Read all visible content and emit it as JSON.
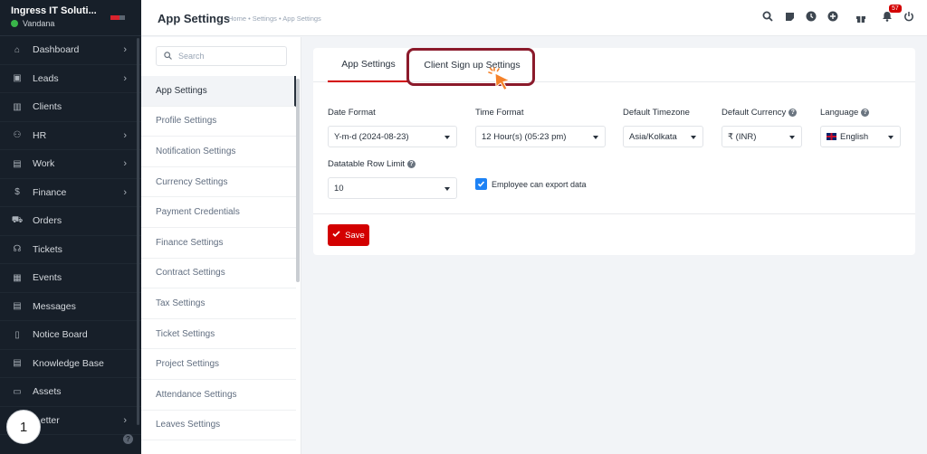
{
  "brand": {
    "name": "Ingress IT Soluti...",
    "user": "Vandana"
  },
  "sidebar": {
    "items": [
      {
        "label": "Dashboard",
        "icon": "home-icon",
        "glyph": "⌂",
        "chevron": true
      },
      {
        "label": "Leads",
        "icon": "leads-icon",
        "glyph": "▣",
        "chevron": true
      },
      {
        "label": "Clients",
        "icon": "clients-icon",
        "glyph": "▥",
        "chevron": false
      },
      {
        "label": "HR",
        "icon": "hr-icon",
        "glyph": "⚇",
        "chevron": true
      },
      {
        "label": "Work",
        "icon": "work-icon",
        "glyph": "▤",
        "chevron": true
      },
      {
        "label": "Finance",
        "icon": "finance-icon",
        "glyph": "$",
        "chevron": true
      },
      {
        "label": "Orders",
        "icon": "orders-icon",
        "glyph": "⛟",
        "chevron": false
      },
      {
        "label": "Tickets",
        "icon": "tickets-icon",
        "glyph": "☊",
        "chevron": false
      },
      {
        "label": "Events",
        "icon": "events-icon",
        "glyph": "▦",
        "chevron": false
      },
      {
        "label": "Messages",
        "icon": "messages-icon",
        "glyph": "▤",
        "chevron": false
      },
      {
        "label": "Notice Board",
        "icon": "notice-board-icon",
        "glyph": "▯",
        "chevron": false
      },
      {
        "label": "Knowledge Base",
        "icon": "knowledge-base-icon",
        "glyph": "▤",
        "chevron": false
      },
      {
        "label": "Assets",
        "icon": "assets-icon",
        "glyph": "▭",
        "chevron": false
      },
      {
        "label": "...etter",
        "icon": "letter-icon",
        "glyph": "",
        "chevron": true
      }
    ]
  },
  "step_badge": "1",
  "header": {
    "title": "App Settings",
    "breadcrumb": "Home • Settings • App Settings",
    "notification_count": "57"
  },
  "submenu": {
    "search_placeholder": "Search",
    "items": [
      "App Settings",
      "Profile Settings",
      "Notification Settings",
      "Currency Settings",
      "Payment Credentials",
      "Finance Settings",
      "Contract Settings",
      "Tax Settings",
      "Ticket Settings",
      "Project Settings",
      "Attendance Settings",
      "Leaves Settings"
    ],
    "active_index": 0
  },
  "tabs": [
    {
      "label": "App Settings",
      "active": true
    },
    {
      "label": "Client Sign up Settings",
      "active": false
    }
  ],
  "form": {
    "date_format": {
      "label": "Date Format",
      "value": "Y-m-d (2024-08-23)"
    },
    "time_format": {
      "label": "Time Format",
      "value": "12 Hour(s) (05:23 pm)"
    },
    "timezone": {
      "label": "Default Timezone",
      "value": "Asia/Kolkata"
    },
    "currency": {
      "label": "Default Currency",
      "value": "₹ (INR)"
    },
    "language": {
      "label": "Language",
      "value": "English"
    },
    "row_limit": {
      "label": "Datatable Row Limit",
      "value": "10"
    },
    "export_checkbox": {
      "label": "Employee can export data",
      "checked": true
    },
    "save_label": "Save"
  },
  "colors": {
    "sidebar_bg": "#171f29",
    "accent_red": "#d30000",
    "checkbox_blue": "#1d82f5",
    "highlight": "#8b1a2b",
    "cursor_orange": "#f5822a"
  }
}
